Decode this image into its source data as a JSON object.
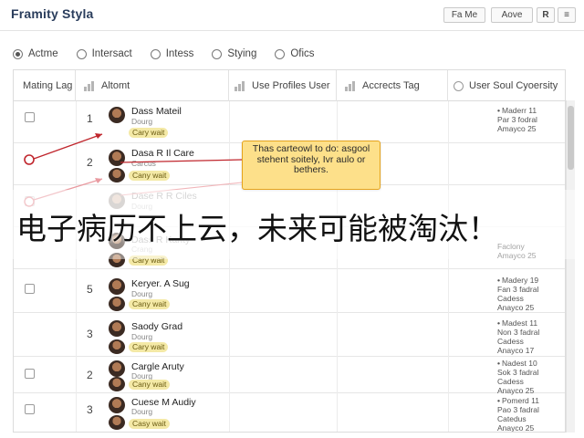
{
  "header": {
    "title": "Framity Styla",
    "buttons": [
      "Fa Me",
      "Aove",
      "R",
      "≡"
    ]
  },
  "filters": {
    "options": [
      "Actme",
      "Intersact",
      "Intess",
      "Stying",
      "Ofics"
    ],
    "selected": "Actme"
  },
  "table": {
    "columns": [
      "Mating Lag",
      "Altomt",
      "Use Profiles User",
      "Accrects Tag",
      "User Soul Cyoersity"
    ],
    "rows": [
      {
        "num": "1",
        "name": "Dass Mateil",
        "sub": "Dourg",
        "tag": "Cary wait",
        "soul": [
          "Maderr 11",
          "Par 3 fodral",
          "Amayco 25"
        ]
      },
      {
        "num": "2",
        "name": "Dasa R Il Care",
        "sub": "Carcus",
        "tag": "Cany wait",
        "soul": []
      },
      {
        "num": "",
        "name": "Dase R R Ciles",
        "sub": "Dourg",
        "tag": "Cary wait",
        "soul": []
      },
      {
        "num": "",
        "name": "Dass R Kanty",
        "sub": "Crang",
        "tag": "Cary wait",
        "soul": [
          "Faclony",
          "Amayco 25"
        ]
      },
      {
        "num": "5",
        "name": "Keryer. A Sug",
        "sub": "Dourg",
        "tag": "Cany wait",
        "soul": [
          "Madery 19",
          "Fan 3 fadral",
          "Cadess",
          "Anayco 25"
        ]
      },
      {
        "num": "3",
        "name": "Saody Grad",
        "sub": "Dourg",
        "tag": "Cary wait",
        "soul": [
          "Madest 11",
          "Non 3 fadral",
          "Cadess",
          "Anayco 17"
        ]
      },
      {
        "num": "2",
        "name": "Cargle Aruty",
        "sub": "Dourg",
        "tag": "Cany wait",
        "soul": [
          "Nadest 10",
          "Sok 3 fadral",
          "Cadess",
          "Anayco 25"
        ]
      },
      {
        "num": "3",
        "name": "Cuese M Audiy",
        "sub": "Dourg",
        "tag": "Casy wait",
        "soul": [
          "Pomerd 11",
          "Pao 3 fadral",
          "Catedus",
          "Anayco 25"
        ]
      }
    ]
  },
  "callout": {
    "text": "Thas carteowl to do: asgool stehent soitely, Ivr aulo or bethers."
  },
  "overlay": {
    "text": "电子病历不上云，未来可能被淘汰！"
  }
}
